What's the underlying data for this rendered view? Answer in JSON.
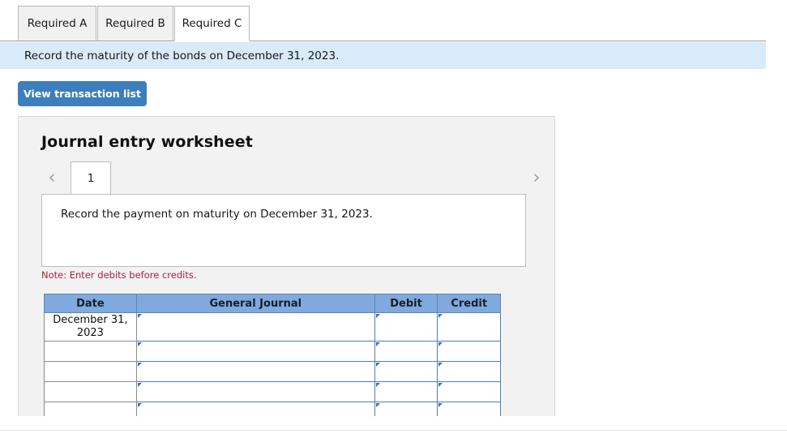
{
  "tabs": [
    {
      "label": "Required A",
      "active": false
    },
    {
      "label": "Required B",
      "active": false
    },
    {
      "label": "Required C",
      "active": true
    }
  ],
  "info_banner": {
    "text": "Record the maturity of the bonds on December 31, 2023."
  },
  "toolbar": {
    "view_transaction_list_label": "View transaction list"
  },
  "worksheet": {
    "title": "Journal entry worksheet",
    "pager": {
      "prev_glyph": "‹",
      "next_glyph": "›",
      "pages": [
        "1"
      ],
      "current_page": "1"
    },
    "description": "Record the payment on maturity on December 31, 2023.",
    "note": "Note: Enter debits before credits.",
    "table": {
      "headers": [
        "Date",
        "General Journal",
        "Debit",
        "Credit"
      ],
      "rows": [
        {
          "date": "December 31, 2023",
          "general_journal": "",
          "debit": "",
          "credit": ""
        },
        {
          "date": "",
          "general_journal": "",
          "debit": "",
          "credit": ""
        },
        {
          "date": "",
          "general_journal": "",
          "debit": "",
          "credit": ""
        },
        {
          "date": "",
          "general_journal": "",
          "debit": "",
          "credit": ""
        },
        {
          "date": "",
          "general_journal": "",
          "debit": "",
          "credit": ""
        },
        {
          "date": "",
          "general_journal": "",
          "debit": "",
          "credit": ""
        }
      ]
    }
  },
  "colors": {
    "accent_blue": "#3d7ebd",
    "banner_blue": "#d9eaf8",
    "table_header_blue": "#80a9dd",
    "note_red": "#a8253a",
    "panel_gray": "#f2f2f2",
    "input_border_blue": "#4a7ebb"
  }
}
